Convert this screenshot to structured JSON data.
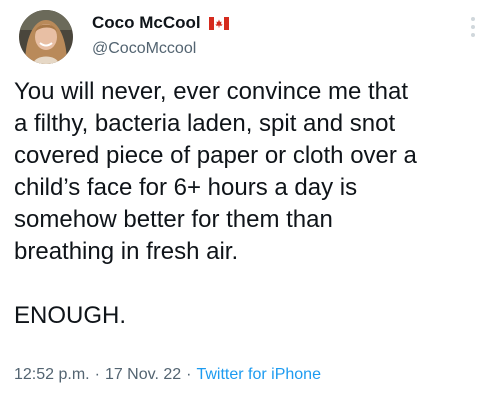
{
  "tweet": {
    "author": {
      "display_name": "Coco McCool",
      "handle": "@CocoMccool",
      "flag_icon": "canada-flag-icon",
      "avatar_icon": "profile-photo"
    },
    "text_lines": [
      "You will never, ever convince me that",
      "a filthy, bacteria laden, spit and snot",
      "covered piece of paper or cloth over a",
      "child’s face for 6+ hours a day is",
      "somehow better for them than",
      "breathing in fresh air."
    ],
    "closing_line": "ENOUGH.",
    "time": "12:52 p.m.",
    "separator": "·",
    "date": "17 Nov. 22",
    "source": "Twitter for iPhone"
  },
  "colors": {
    "text": "#0f1419",
    "secondary": "#536471",
    "link": "#1d9bf0",
    "flag_red": "#d52b1e"
  }
}
